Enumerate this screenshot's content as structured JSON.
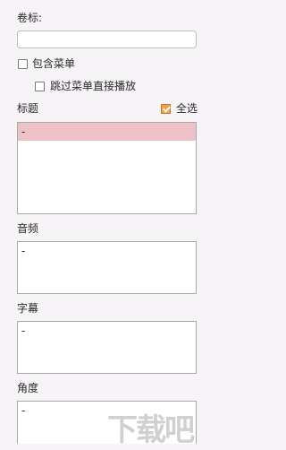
{
  "volume": {
    "label": "卷标:",
    "value": "",
    "placeholder": ""
  },
  "include_menu": {
    "label": "包含菜单",
    "checked": false
  },
  "skip_menu": {
    "label": "跳过菜单直接播放",
    "checked": false
  },
  "titles": {
    "label": "标题",
    "select_all_label": "全选",
    "select_all_checked": true,
    "items": [
      "-"
    ]
  },
  "audio": {
    "label": "音频",
    "items": [
      "-"
    ]
  },
  "subtitles": {
    "label": "字幕",
    "items": [
      "-"
    ]
  },
  "angle": {
    "label": "角度",
    "items": [
      "-"
    ]
  },
  "watermark": {
    "text": "下载吧"
  },
  "colors": {
    "selected_row": "#ecc2c7",
    "checkbox_checked": "#f0a24a"
  }
}
